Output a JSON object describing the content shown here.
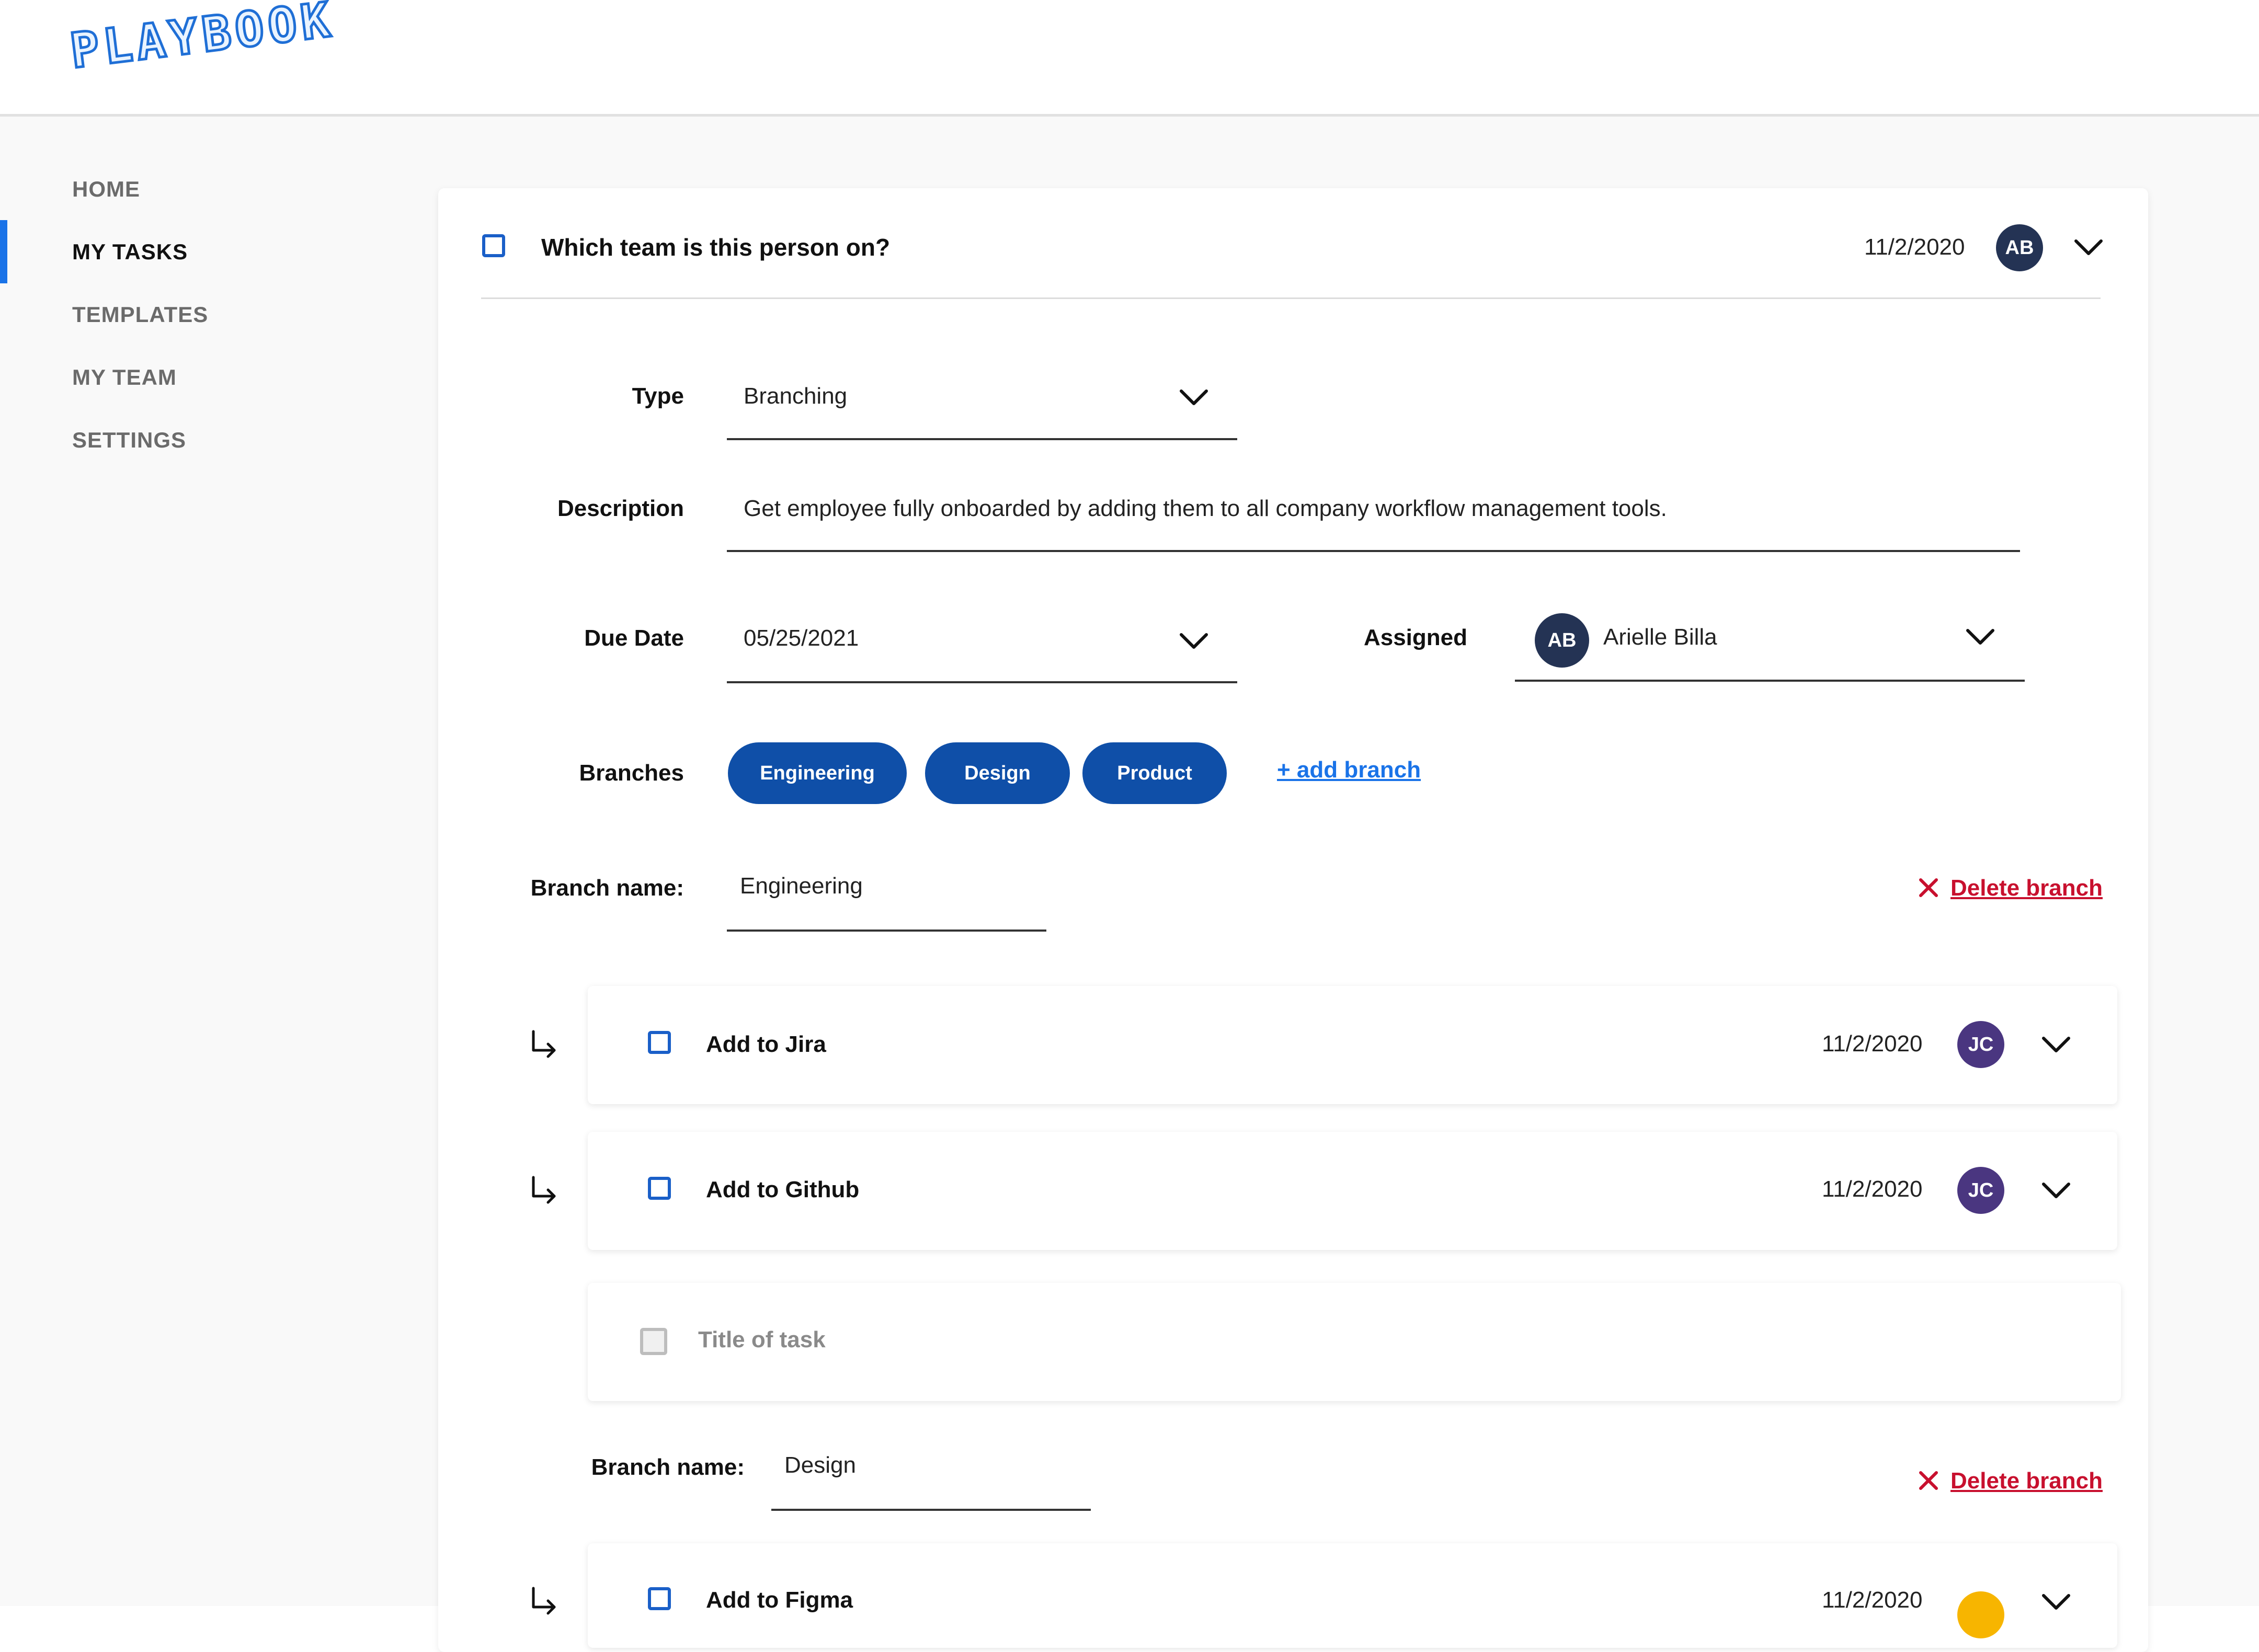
{
  "app": {
    "logo_text": "PLAYBOOK"
  },
  "nav": {
    "items": [
      {
        "label": "HOME"
      },
      {
        "label": "MY TASKS"
      },
      {
        "label": "TEMPLATES"
      },
      {
        "label": "MY TEAM"
      },
      {
        "label": "SETTINGS"
      }
    ],
    "active_index": 1
  },
  "task": {
    "title": "Which team is this person on?",
    "date": "11/2/2020",
    "assignee_initials": "AB"
  },
  "form": {
    "type_label": "Type",
    "type_value": "Branching",
    "description_label": "Description",
    "description_value": "Get employee fully onboarded by adding them to all company workflow management tools.",
    "due_label": "Due Date",
    "due_value": "05/25/2021",
    "assigned_label": "Assigned",
    "assigned_initials": "AB",
    "assigned_name": "Arielle Billa",
    "branches_label": "Branches",
    "branches": [
      "Engineering",
      "Design",
      "Product"
    ],
    "add_branch": "+ add branch"
  },
  "branch_sections": [
    {
      "name_label": "Branch name:",
      "name_value": "Engineering",
      "delete_label": "Delete branch",
      "subtasks": [
        {
          "title": "Add to Jira",
          "date": "11/2/2020",
          "initials": "JC"
        },
        {
          "title": "Add to Github",
          "date": "11/2/2020",
          "initials": "JC"
        }
      ],
      "new_task_placeholder": "Title of task"
    },
    {
      "name_label": "Branch name:",
      "name_value": "Design",
      "delete_label": "Delete branch",
      "subtasks": [
        {
          "title": "Add to Figma",
          "date": "11/2/2020",
          "initials": ""
        }
      ]
    }
  ],
  "colors": {
    "primary": "#1a73e8",
    "pill": "#0f4fa8",
    "danger": "#c8102e",
    "avatar_navy": "#243354",
    "avatar_purple": "#4a3680",
    "avatar_yellow": "#f7b500"
  }
}
